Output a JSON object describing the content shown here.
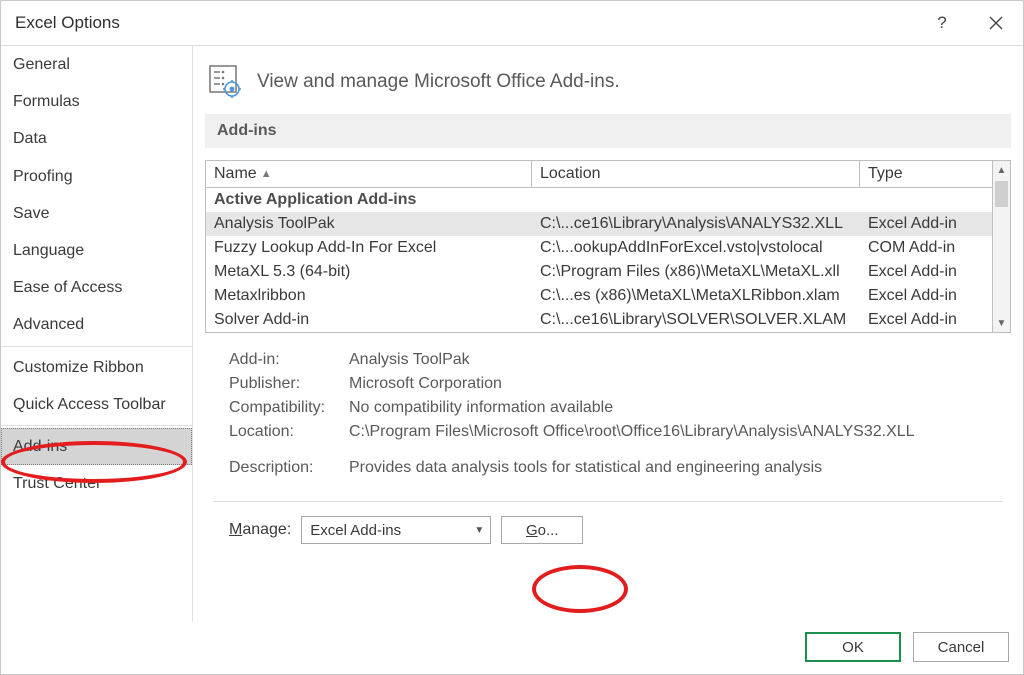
{
  "title": "Excel Options",
  "sidebar": {
    "items": [
      {
        "label": "General"
      },
      {
        "label": "Formulas"
      },
      {
        "label": "Data"
      },
      {
        "label": "Proofing"
      },
      {
        "label": "Save"
      },
      {
        "label": "Language"
      },
      {
        "label": "Ease of Access"
      },
      {
        "label": "Advanced"
      }
    ],
    "items2": [
      {
        "label": "Customize Ribbon"
      },
      {
        "label": "Quick Access Toolbar"
      }
    ],
    "items3": [
      {
        "label": "Add-ins",
        "selected": true
      },
      {
        "label": "Trust Center"
      }
    ]
  },
  "header_text": "View and manage Microsoft Office Add-ins.",
  "section_title": "Add-ins",
  "columns": {
    "name": "Name",
    "location": "Location",
    "type": "Type"
  },
  "group_header": "Active Application Add-ins",
  "rows": [
    {
      "name": "Analysis ToolPak",
      "location": "C:\\...ce16\\Library\\Analysis\\ANALYS32.XLL",
      "type": "Excel Add-in",
      "selected": true
    },
    {
      "name": "Fuzzy Lookup Add-In For Excel",
      "location": "C:\\...ookupAddInForExcel.vsto|vstolocal",
      "type": "COM Add-in"
    },
    {
      "name": "MetaXL 5.3 (64-bit)",
      "location": "C:\\Program Files (x86)\\MetaXL\\MetaXL.xll",
      "type": "Excel Add-in"
    },
    {
      "name": "Metaxlribbon",
      "location": "C:\\...es (x86)\\MetaXL\\MetaXLRibbon.xlam",
      "type": "Excel Add-in"
    },
    {
      "name": "Solver Add-in",
      "location": "C:\\...ce16\\Library\\SOLVER\\SOLVER.XLAM",
      "type": "Excel Add-in"
    }
  ],
  "details": {
    "labels": {
      "addin": "Add-in:",
      "publisher": "Publisher:",
      "compat": "Compatibility:",
      "location": "Location:",
      "desc": "Description:"
    },
    "addin": "Analysis ToolPak",
    "publisher": "Microsoft Corporation",
    "compat": "No compatibility information available",
    "location": "C:\\Program Files\\Microsoft Office\\root\\Office16\\Library\\Analysis\\ANALYS32.XLL",
    "desc": "Provides data analysis tools for statistical and engineering analysis"
  },
  "manage": {
    "label": "Manage:",
    "value": "Excel Add-ins",
    "go": "Go..."
  },
  "buttons": {
    "ok": "OK",
    "cancel": "Cancel"
  }
}
